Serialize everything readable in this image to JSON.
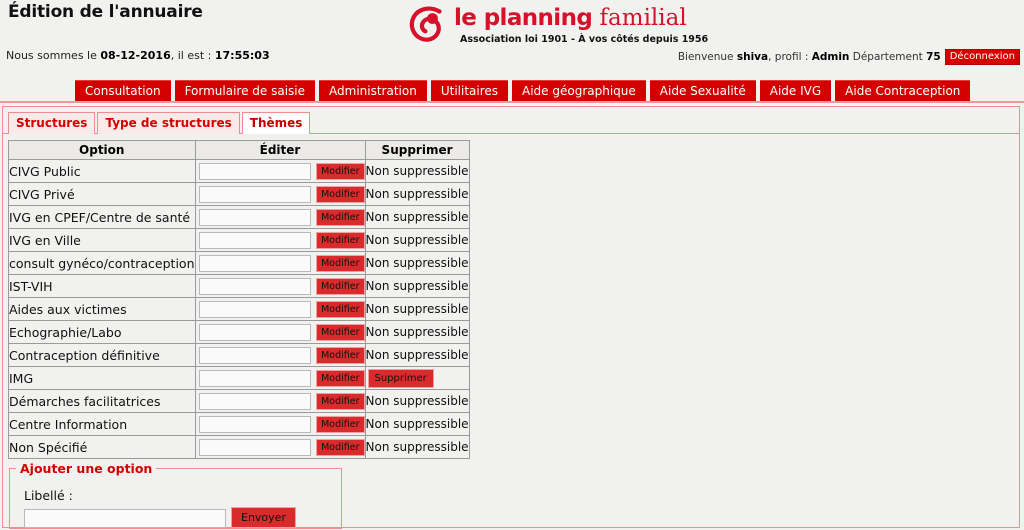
{
  "header": {
    "page_title": "Édition de l'annuaire",
    "logo": {
      "name_bold": "le planning",
      "name_light": " familial",
      "tagline": "Association loi 1901 - À vos côtés depuis 1956",
      "mark": "spiral-logo-icon",
      "color": "#d6112a"
    },
    "datetime_prefix": "Nous sommes le ",
    "date": "08-12-2016",
    "datetime_mid": ", il est : ",
    "time": "17:55:03",
    "welcome_prefix": "Bienvenue ",
    "user": "shiva",
    "profile_prefix": ", profil : ",
    "profile": "Admin",
    "department_prefix": " Département ",
    "department": "75",
    "logout_label": "Déconnexion"
  },
  "mainnav": {
    "items": [
      {
        "label": "Consultation"
      },
      {
        "label": "Formulaire de saisie"
      },
      {
        "label": "Administration"
      },
      {
        "label": "Utilitaires"
      },
      {
        "label": "Aide géographique"
      },
      {
        "label": "Aide Sexualité"
      },
      {
        "label": "Aide IVG"
      },
      {
        "label": "Aide Contraception"
      }
    ]
  },
  "subtabs": [
    {
      "label": "Structures",
      "active": false
    },
    {
      "label": "Type de structures",
      "active": false
    },
    {
      "label": "Thèmes",
      "active": true
    }
  ],
  "table": {
    "headers": [
      "Option",
      "Éditer",
      "Supprimer"
    ],
    "edit_button_label": "Modifier",
    "delete_button_label": "Supprimer",
    "not_deletable_label": "Non suppressible",
    "input_value": "",
    "rows": [
      {
        "option": "CIVG Public",
        "value": "",
        "deletable": false
      },
      {
        "option": "CIVG Privé",
        "value": "",
        "deletable": false
      },
      {
        "option": "IVG en CPEF/Centre de santé",
        "value": "",
        "deletable": false
      },
      {
        "option": "IVG en Ville",
        "value": "",
        "deletable": false
      },
      {
        "option": "consult gynéco/contraception",
        "value": "",
        "deletable": false
      },
      {
        "option": "IST-VIH",
        "value": "",
        "deletable": false
      },
      {
        "option": "Aides aux victimes",
        "value": "",
        "deletable": false
      },
      {
        "option": "Echographie/Labo",
        "value": "",
        "deletable": false
      },
      {
        "option": "Contraception définitive",
        "value": "",
        "deletable": false
      },
      {
        "option": "IMG",
        "value": "",
        "deletable": true
      },
      {
        "option": "Démarches facilitatrices",
        "value": "",
        "deletable": false
      },
      {
        "option": "Centre Information",
        "value": "",
        "deletable": false
      },
      {
        "option": "Non Spécifié",
        "value": "",
        "deletable": false
      }
    ]
  },
  "add_option": {
    "legend": "Ajouter une option",
    "label": "Libellé :",
    "input_value": "",
    "submit_label": "Envoyer"
  },
  "colors": {
    "brand_red": "#d40000",
    "button_red": "#d92b2b",
    "border_pink": "#ef8f8f",
    "page_bg": "#f1f1ef"
  }
}
